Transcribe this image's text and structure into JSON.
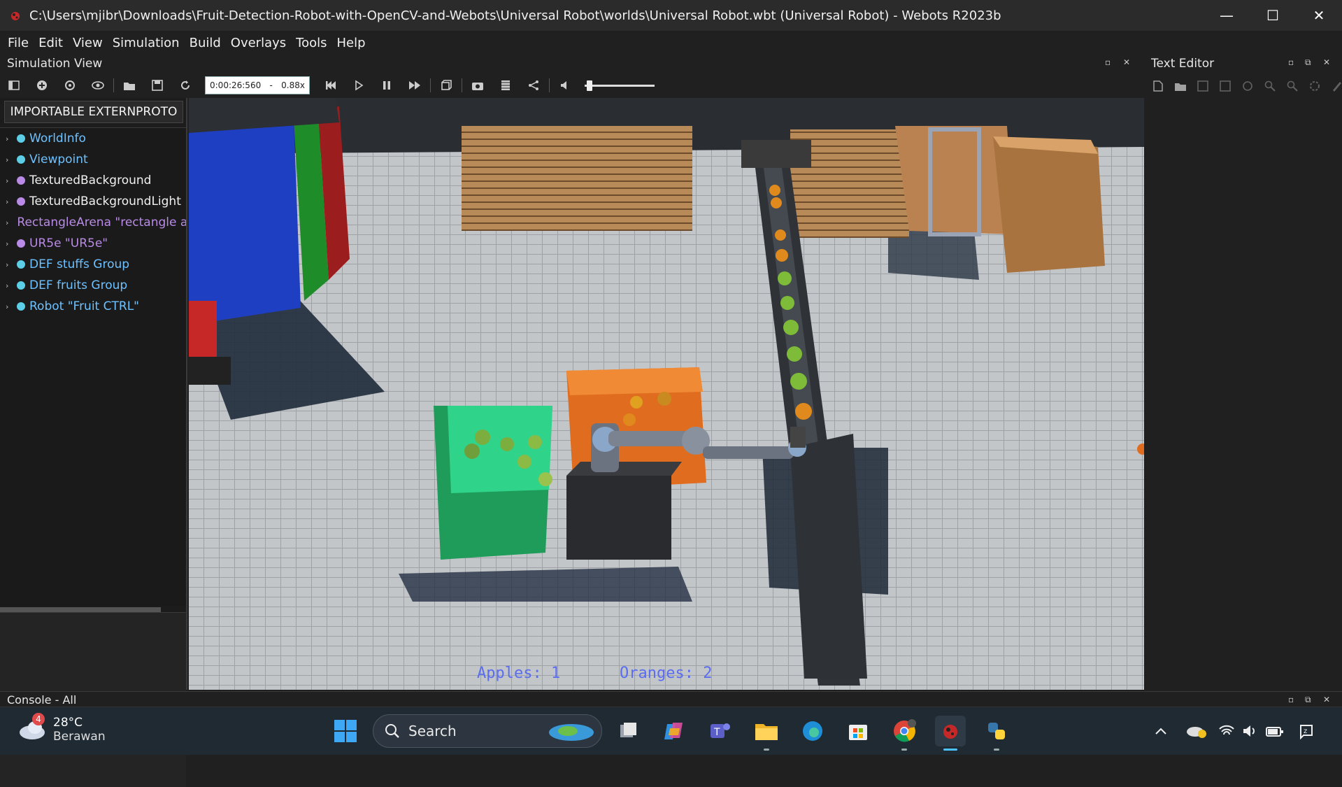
{
  "window": {
    "title": "C:\\Users\\mjibr\\Downloads\\Fruit-Detection-Robot-with-OpenCV-and-Webots\\Universal Robot\\worlds\\Universal Robot.wbt (Universal Robot) - Webots R2023b",
    "minimize": "—",
    "maximize": "☐",
    "close": "✕"
  },
  "menu": [
    "File",
    "Edit",
    "View",
    "Simulation",
    "Build",
    "Overlays",
    "Tools",
    "Help"
  ],
  "simulation_view": {
    "title": "Simulation View",
    "time": "0:00:26:560",
    "time_sep": "-",
    "speed": "0.88x",
    "volume_fraction": 0.03
  },
  "text_editor": {
    "title": "Text Editor"
  },
  "scene_tree": {
    "externproto_label": "IMPORTABLE EXTERNPROTO",
    "items": [
      {
        "label": "WorldInfo",
        "color": "#5ccfe6",
        "text_color": "#6ec1ff"
      },
      {
        "label": "Viewpoint",
        "color": "#5ccfe6",
        "text_color": "#6ec1ff"
      },
      {
        "label": "TexturedBackground",
        "color": "#b98be6",
        "text_color": "#f0f0f0"
      },
      {
        "label": "TexturedBackgroundLight",
        "color": "#b98be6",
        "text_color": "#f0f0f0"
      },
      {
        "label": "RectangleArena \"rectangle ar",
        "color": "#b98be6",
        "text_color": "#b98be6"
      },
      {
        "label": "UR5e \"UR5e\"",
        "color": "#b98be6",
        "text_color": "#b98be6"
      },
      {
        "label": "DEF stuffs Group",
        "color": "#5ccfe6",
        "text_color": "#6ec1ff"
      },
      {
        "label": "DEF fruits Group",
        "color": "#5ccfe6",
        "text_color": "#6ec1ff"
      },
      {
        "label": "Robot \"Fruit CTRL\"",
        "color": "#5ccfe6",
        "text_color": "#6ec1ff"
      }
    ]
  },
  "overlay": {
    "apples": "Apples: 1",
    "oranges": "Oranges: 2"
  },
  "console": {
    "title": "Console - All"
  },
  "taskbar": {
    "weather_badge": "4",
    "temperature": "28°C",
    "condition": "Berawan",
    "search_label": "Search"
  },
  "colors": {
    "accent": "#2a7fd4",
    "bg": "#202020",
    "tree_bg": "#1a1a1a"
  }
}
